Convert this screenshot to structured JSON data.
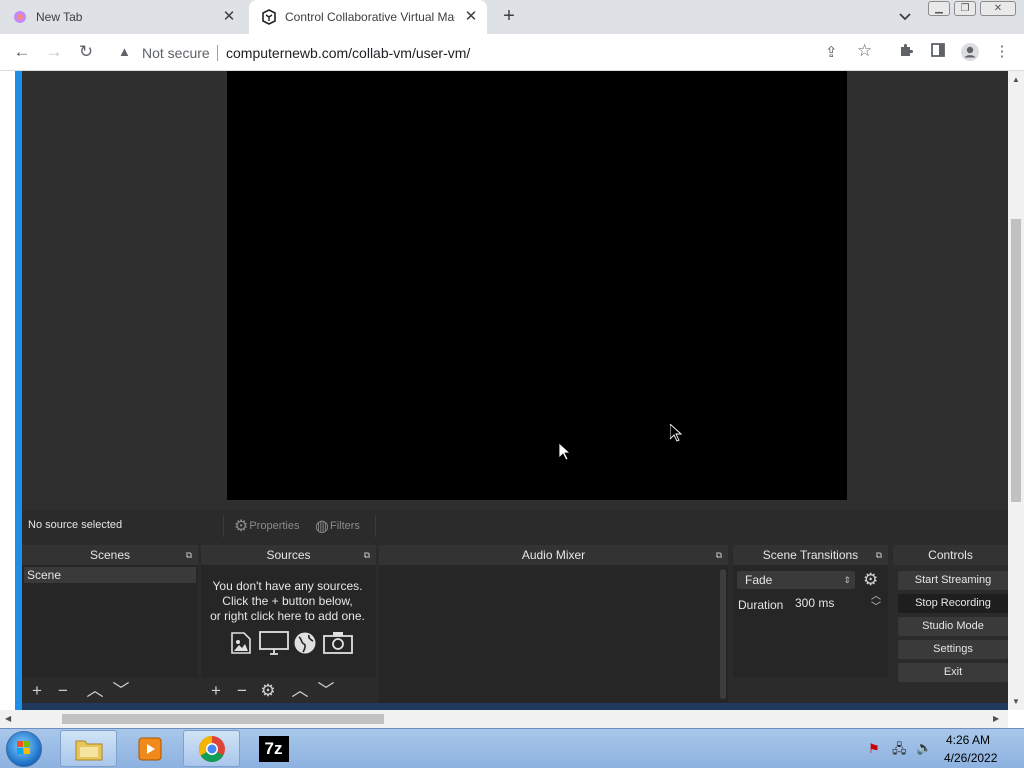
{
  "browser": {
    "tabs": [
      {
        "title": "New Tab",
        "active": false
      },
      {
        "title": "Control Collaborative Virtual Machine",
        "active": true
      }
    ],
    "address": {
      "security_label": "Not secure",
      "url": "computernewb.com/collab-vm/user-vm/"
    }
  },
  "obs": {
    "source_status": "No source selected",
    "properties_label": "Properties",
    "filters_label": "Filters",
    "docks": {
      "scenes": "Scenes",
      "sources": "Sources",
      "audio_mixer": "Audio Mixer",
      "scene_transitions": "Scene Transitions",
      "controls": "Controls"
    },
    "scenes": [
      "Scene"
    ],
    "sources_empty": [
      "You don't have any sources.",
      "Click the + button below,",
      "or right click here to add one."
    ],
    "transition": {
      "type": "Fade",
      "duration_label": "Duration",
      "duration_value": "300 ms"
    },
    "controls": [
      "Start Streaming",
      "Stop Recording",
      "Studio Mode",
      "Settings",
      "Exit"
    ]
  },
  "taskbar": {
    "time": "4:26 AM",
    "date": "4/26/2022",
    "apps": [
      "file-explorer",
      "media-player",
      "chrome",
      "7-zip"
    ],
    "seven_zip_label": "7z"
  }
}
